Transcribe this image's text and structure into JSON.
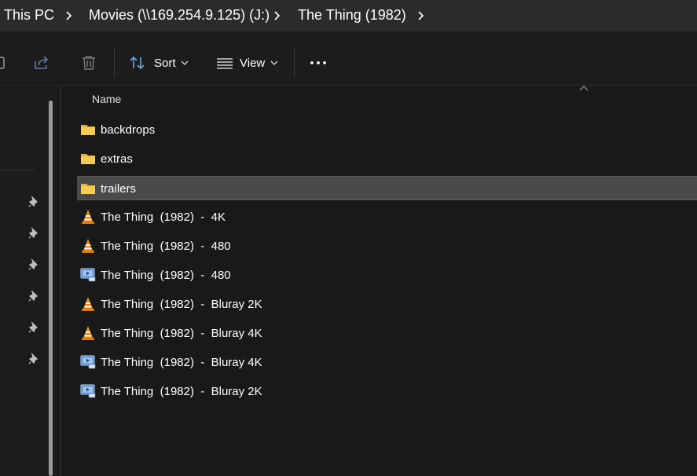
{
  "breadcrumb": {
    "items": [
      "This PC",
      "Movies (\\\\169.254.9.125) (J:)",
      "The Thing (1982)"
    ]
  },
  "toolbar": {
    "share_icon": "share-icon",
    "delete_icon": "trash-icon",
    "sort_label": "Sort",
    "view_label": "View",
    "more_icon": "more-icon"
  },
  "list": {
    "column_name": "Name",
    "items": [
      {
        "name": "backdrops",
        "icon": "folder-icon"
      },
      {
        "name": "extras",
        "icon": "folder-icon"
      },
      {
        "name": "trailers",
        "icon": "folder-icon",
        "selected": true
      },
      {
        "name": "The Thing  (1982)  -  4K",
        "icon": "vlc-icon"
      },
      {
        "name": "The Thing  (1982)  -  480",
        "icon": "vlc-icon"
      },
      {
        "name": "The Thing  (1982)  -  480",
        "icon": "media-player-icon"
      },
      {
        "name": "The Thing  (1982)  -  Bluray 2K",
        "icon": "vlc-icon"
      },
      {
        "name": "The Thing  (1982)  -  Bluray 4K",
        "icon": "vlc-icon"
      },
      {
        "name": "The Thing  (1982)  -  Bluray 4K",
        "icon": "media-player-icon"
      },
      {
        "name": "The Thing  (1982)  -  Bluray 2K",
        "icon": "media-player-icon"
      }
    ]
  },
  "colors": {
    "background": "#191919",
    "selected_row": "#4a4a4a",
    "folder": "#f5c242",
    "vlc_orange": "#f08a0c"
  }
}
